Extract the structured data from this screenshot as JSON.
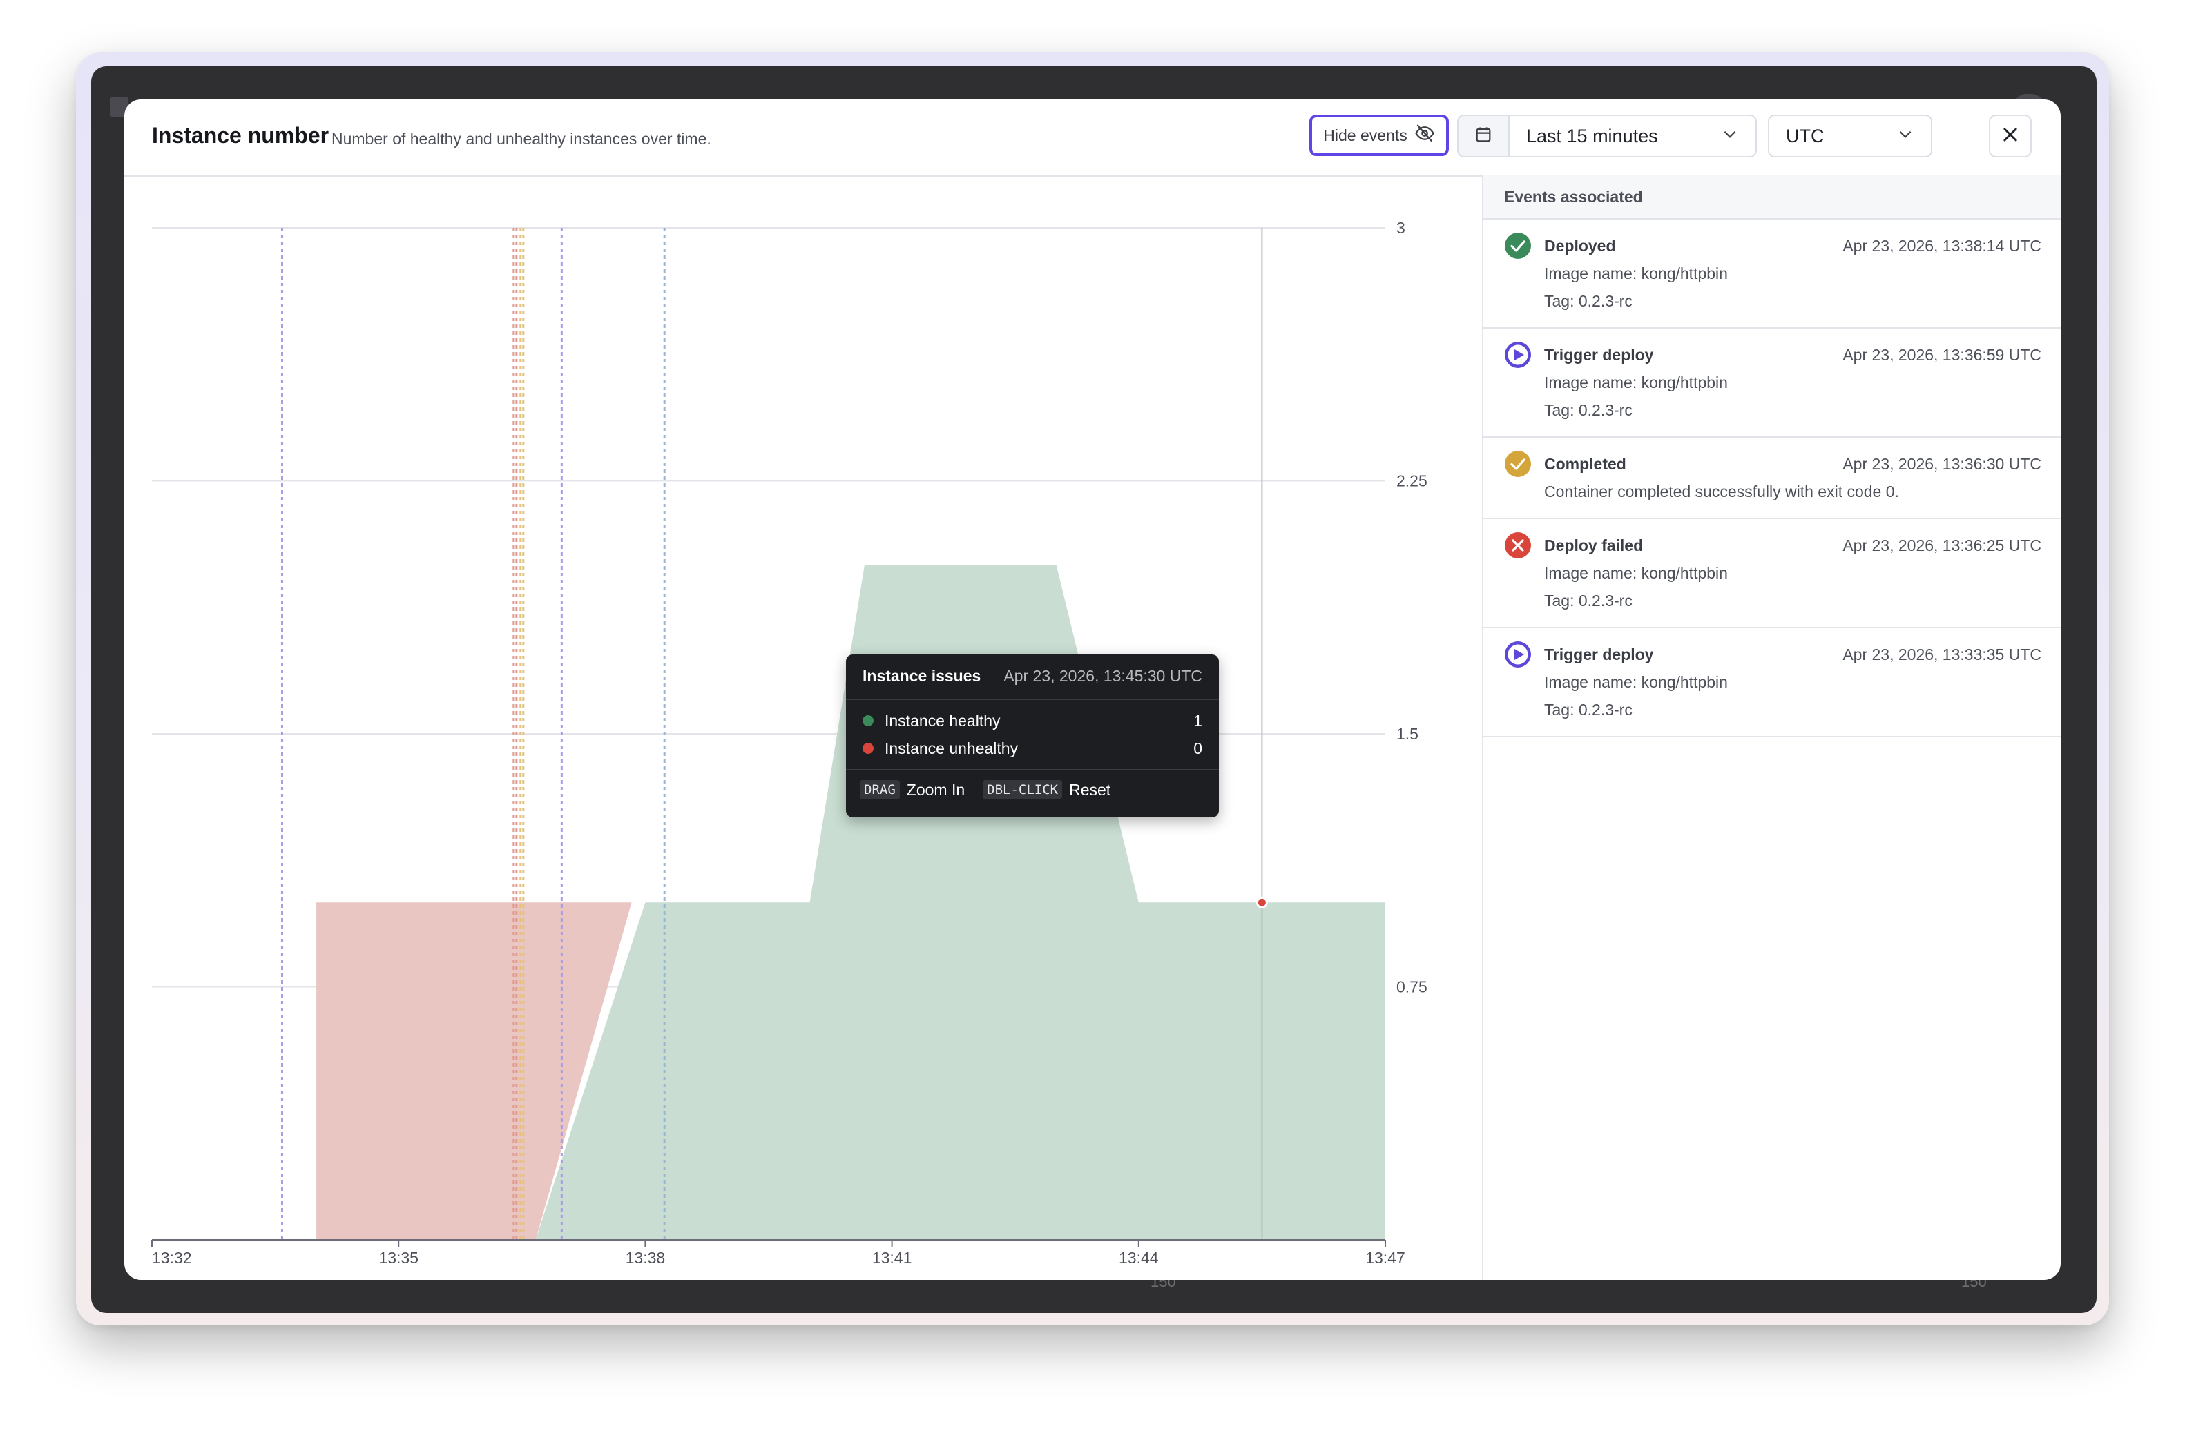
{
  "modal": {
    "title": "Instance number",
    "subtitle": "Number of healthy and unhealthy instances over time."
  },
  "toolbar": {
    "hide_events_label": "Hide events",
    "range_value": "Last 15 minutes",
    "timezone_value": "UTC"
  },
  "background": {
    "tick_label_a": "150",
    "tick_label_b": "150"
  },
  "events": {
    "header": "Events associated",
    "items": [
      {
        "status": "success",
        "title": "Deployed",
        "time": "Apr 23, 2026, 13:38:14 UTC",
        "lines": [
          "Image name: kong/httpbin",
          "Tag: 0.2.3-rc"
        ],
        "icon": "check-circle-icon",
        "color": "#3a8a5b"
      },
      {
        "status": "trigger",
        "title": "Trigger deploy",
        "time": "Apr 23, 2026, 13:36:59 UTC",
        "lines": [
          "Image name: kong/httpbin",
          "Tag: 0.2.3-rc"
        ],
        "icon": "play-circle-icon",
        "color": "#5b48d8"
      },
      {
        "status": "completed",
        "title": "Completed",
        "time": "Apr 23, 2026, 13:36:30 UTC",
        "lines": [
          "Container completed successfully with exit code 0."
        ],
        "icon": "check-circle-icon",
        "color": "#d4a53a"
      },
      {
        "status": "failed",
        "title": "Deploy failed",
        "time": "Apr 23, 2026, 13:36:25 UTC",
        "lines": [
          "Image name: kong/httpbin",
          "Tag: 0.2.3-rc"
        ],
        "icon": "x-circle-icon",
        "color": "#d9453a"
      },
      {
        "status": "trigger",
        "title": "Trigger deploy",
        "time": "Apr 23, 2026, 13:33:35 UTC",
        "lines": [
          "Image name: kong/httpbin",
          "Tag: 0.2.3-rc"
        ],
        "icon": "play-circle-icon",
        "color": "#5b48d8"
      }
    ]
  },
  "tooltip": {
    "title": "Instance issues",
    "time": "Apr 23, 2026, 13:45:30 UTC",
    "rows": [
      {
        "label": "Instance healthy",
        "value": "1",
        "color": "#3a8a5b"
      },
      {
        "label": "Instance unhealthy",
        "value": "0",
        "color": "#d9453a"
      }
    ],
    "drag_key": "DRAG",
    "drag_label": "Zoom In",
    "dbl_key": "DBL-CLICK",
    "dbl_label": "Reset"
  },
  "chart_data": {
    "type": "area",
    "title": "",
    "xlabel": "",
    "ylabel": "",
    "x_tick_labels": [
      "13:32",
      "13:35",
      "13:38",
      "13:41",
      "13:44",
      "13:47"
    ],
    "x_range": [
      "13:32",
      "13:47"
    ],
    "y_ticks": [
      "0.75",
      "1.5",
      "2.25",
      "3"
    ],
    "ylim": [
      0,
      3
    ],
    "grid": true,
    "series": [
      {
        "name": "Instance unhealthy",
        "color": "#e8c3be",
        "points": [
          [
            "13:34:00",
            1
          ],
          [
            "13:37:50",
            1
          ],
          [
            "13:36:40",
            0
          ],
          [
            "13:34:00",
            0
          ]
        ]
      },
      {
        "name": "Instance healthy",
        "color": "#c6dbd0",
        "points": [
          [
            "13:36:40",
            0
          ],
          [
            "13:38:00",
            1
          ],
          [
            "13:40:00",
            1
          ],
          [
            "13:40:40",
            2
          ],
          [
            "13:43:00",
            2
          ],
          [
            "13:44:00",
            1
          ],
          [
            "13:47:00",
            1
          ],
          [
            "13:47:00",
            0
          ]
        ]
      }
    ],
    "event_markers": [
      {
        "time": "13:33:35",
        "color": "#a99be8"
      },
      {
        "time": "13:36:25",
        "color": "#e29a8f"
      },
      {
        "time": "13:36:30",
        "color": "#e4c27a"
      },
      {
        "time": "13:36:59",
        "color": "#a99be8"
      },
      {
        "time": "13:38:14",
        "color": "#9ab6d4"
      }
    ],
    "hover": {
      "time": "13:45:30",
      "value": 1
    }
  }
}
